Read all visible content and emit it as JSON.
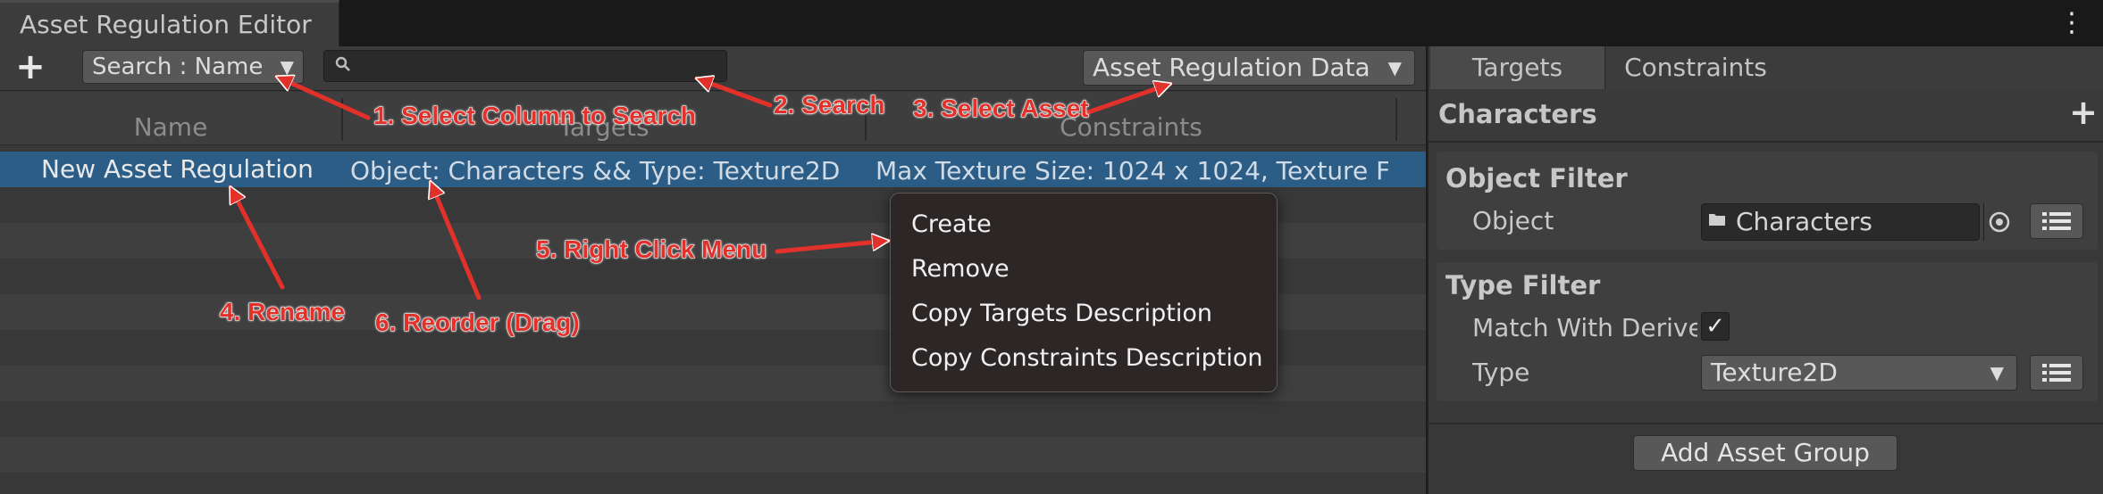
{
  "window": {
    "title": "Asset Regulation Editor",
    "menu_icon": "⋮"
  },
  "toolbar": {
    "add_icon": "+",
    "search_column": "Search : Name",
    "search_value": "",
    "asset_dropdown": "Asset Regulation Data"
  },
  "table": {
    "columns": [
      "Name",
      "Targets",
      "Constraints"
    ],
    "rows": [
      {
        "name": "New Asset Regulation",
        "targets": "Object: Characters && Type: Texture2D",
        "constraints": "Max Texture Size: 1024 x 1024, Texture F"
      }
    ]
  },
  "context_menu": {
    "items": [
      "Create",
      "Remove",
      "Copy Targets Description",
      "Copy Constraints Description"
    ]
  },
  "inspector": {
    "tabs": [
      "Targets",
      "Constraints"
    ],
    "active_tab": "Targets",
    "group_title": "Characters",
    "add_icon": "+",
    "object_filter": {
      "title": "Object Filter",
      "label": "Object",
      "value": "Characters"
    },
    "type_filter": {
      "title": "Type Filter",
      "match_label": "Match With Derive",
      "match_checked": true,
      "type_label": "Type",
      "type_value": "Texture2D"
    },
    "add_group_label": "Add Asset Group"
  },
  "annotations": {
    "a1": "1. Select Column to Search",
    "a2": "2. Search",
    "a3": "3. Select Asset",
    "a4": "4. Rename",
    "a5": "5. Right Click Menu",
    "a6": "6. Reorder (Drag)"
  },
  "colors": {
    "selection": "#2c5d87",
    "annotation": "#e2312a",
    "panel": "#383838"
  }
}
